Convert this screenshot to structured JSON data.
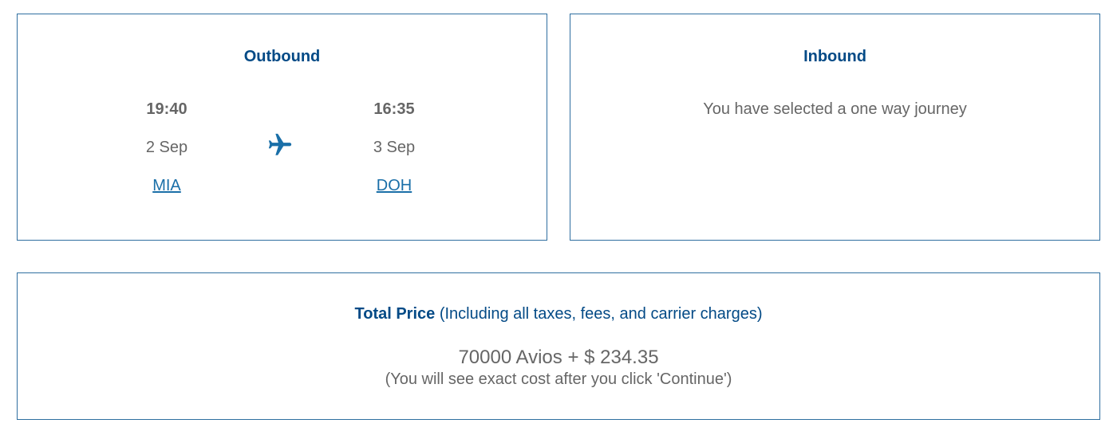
{
  "outbound": {
    "title": "Outbound",
    "depart": {
      "time": "19:40",
      "date": "2 Sep",
      "airport": "MIA"
    },
    "arrive": {
      "time": "16:35",
      "date": "3 Sep",
      "airport": "DOH"
    },
    "icon": "airplane-icon",
    "accent": "#1a6fa8"
  },
  "inbound": {
    "title": "Inbound",
    "message": "You have selected a one way journey"
  },
  "price": {
    "label": "Total Price",
    "qualifier": "(Including all taxes, fees, and carrier charges)",
    "amount": "70000 Avios + $ 234.35",
    "note": "(You will see exact cost after you click 'Continue')"
  },
  "colors": {
    "border": "#2f6fa0",
    "heading": "#034a86",
    "text": "#666666",
    "link": "#1a6fa8"
  }
}
